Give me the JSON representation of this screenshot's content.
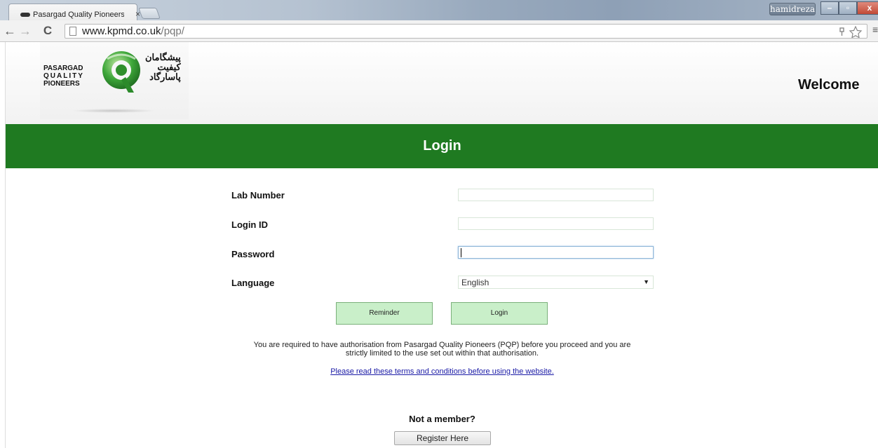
{
  "browser": {
    "tab_title": "Pasargad Quality Pioneers",
    "tab_close": "×",
    "user_name": "hamidreza",
    "url_host": "www.kpmd.co.uk",
    "url_path": "/pqp/",
    "back_icon": "←",
    "forward_icon": "→",
    "reload_icon": "C",
    "min_icon": "–",
    "restore_icon": "▫",
    "close_icon": "x",
    "menu_icon": "≡"
  },
  "header": {
    "logo_en_line1": "PASARGAD",
    "logo_en_line2": "QUALITY",
    "logo_en_line3": "PIONEERS",
    "logo_fa_line1": "پیشگامان",
    "logo_fa_line2": "کیفیت",
    "logo_fa_line3": "پاسارگاد",
    "welcome": "Welcome"
  },
  "login_bar": {
    "title": "Login"
  },
  "form": {
    "lab_number_label": "Lab Number",
    "lab_number_value": "",
    "login_id_label": "Login ID",
    "login_id_value": "",
    "password_label": "Password",
    "password_value": "",
    "language_label": "Language",
    "language_value": "English"
  },
  "buttons": {
    "reminder": "Reminder",
    "login": "Login",
    "register": "Register Here"
  },
  "notice_line1": "You are required to have authorisation from Pasargad Quality Pioneers (PQP) before you proceed and you are",
  "notice_line2": "strictly limited to the use set out within that authorisation.",
  "terms_link": "Please read these terms and conditions before using the website.",
  "not_member": "Not a member?",
  "colors": {
    "brand_green": "#1f7a21",
    "button_green": "#c9efc9",
    "link_blue": "#1a1aa6"
  }
}
